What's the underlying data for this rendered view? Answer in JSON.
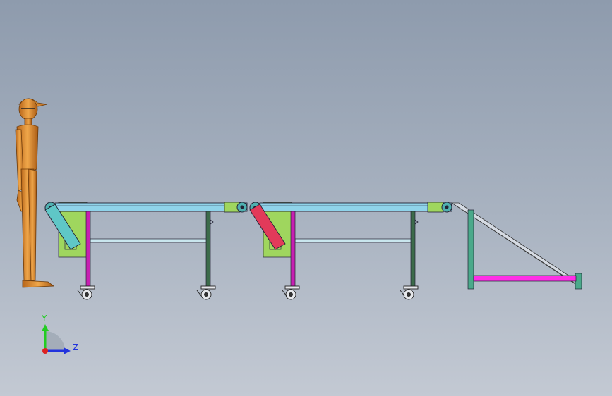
{
  "scene": {
    "colors": {
      "belt": "#8fd3ea",
      "frame_plate": "#9fd65e",
      "leg_magenta": "#c81fb2",
      "leg_dark": "#3c6b4a",
      "infeed_cyan": "#5fc7c7",
      "infeed_red": "#e23a5a",
      "ramp_bar": "#ff2ee6",
      "ramp_post": "#4aa98a",
      "human": "#d7892a"
    }
  },
  "triad": {
    "y_label": "Y",
    "z_label": "Z",
    "y_color": "#22cc22",
    "z_color": "#2233dd",
    "origin_color": "#dd2222"
  }
}
